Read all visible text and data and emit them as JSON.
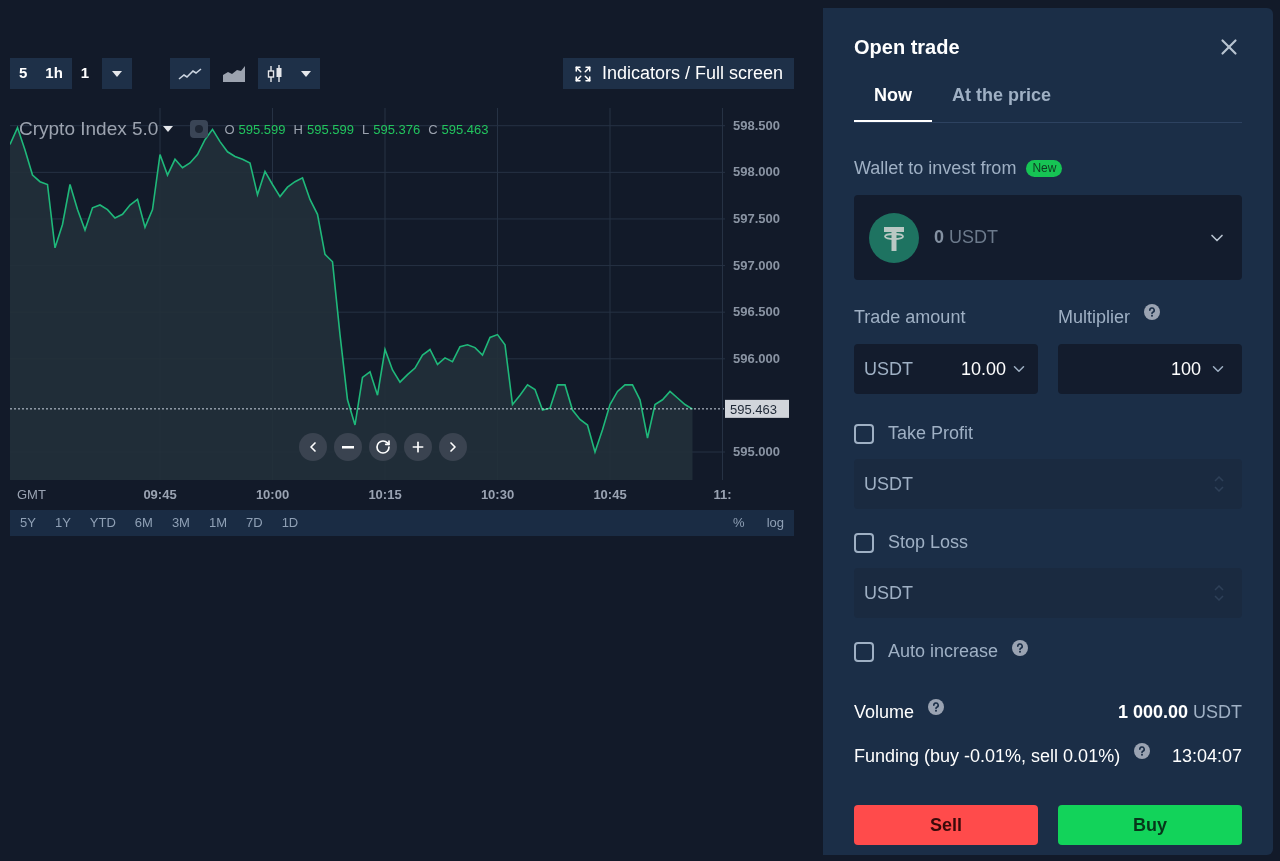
{
  "toolbar": {
    "intervals": [
      {
        "label": "5",
        "selected": false
      },
      {
        "label": "1h",
        "selected": false
      },
      {
        "label": "1",
        "selected": true
      }
    ],
    "chart_types": [
      {
        "kind": "line",
        "selected": false
      },
      {
        "kind": "area",
        "selected": true
      },
      {
        "kind": "candles",
        "selected": false
      }
    ],
    "indicators_button": "Indicators / Full screen"
  },
  "chart": {
    "ohlc": [
      {
        "label": "O",
        "value": "595.599"
      },
      {
        "label": "H",
        "value": "595.599"
      },
      {
        "label": "L",
        "value": "595.376"
      },
      {
        "label": "C",
        "value": "595.463"
      }
    ],
    "time_zone": "GMT",
    "cut_time_label": "11:",
    "chart_data": {
      "type": "area",
      "grid": true,
      "ylim": [
        594.7,
        598.69
      ],
      "ref_lines": [
        {
          "axis": "y",
          "value": 595.463,
          "label": "595.463"
        }
      ],
      "categories": [
        null,
        null,
        null,
        null,
        null,
        null,
        null,
        null,
        null,
        null,
        null,
        null,
        null,
        null,
        null,
        null,
        null,
        null,
        null,
        null,
        "09:45",
        null,
        null,
        null,
        null,
        null,
        null,
        null,
        null,
        null,
        null,
        null,
        null,
        null,
        null,
        "10:00",
        null,
        null,
        null,
        null,
        null,
        null,
        null,
        null,
        null,
        null,
        null,
        null,
        null,
        null,
        "10:15",
        null,
        null,
        null,
        null,
        null,
        null,
        null,
        null,
        null,
        null,
        null,
        null,
        null,
        null,
        "10:30",
        null,
        null,
        null,
        null,
        null,
        null,
        null,
        null,
        null,
        null,
        null,
        null,
        null,
        null,
        "10:45",
        null,
        null,
        null,
        null,
        null,
        null,
        null,
        null,
        null,
        null,
        null,
        null,
        null,
        null,
        null
      ],
      "yticks": [
        {
          "value": 595,
          "label": "595.000"
        },
        {
          "value": 596,
          "label": "596.000"
        },
        {
          "value": 596.5,
          "label": "596.500"
        },
        {
          "value": 597,
          "label": "597.000"
        },
        {
          "value": 597.5,
          "label": "597.500"
        },
        {
          "value": 598,
          "label": "598.000"
        },
        {
          "value": 598.5,
          "label": "598.500"
        }
      ],
      "series": [
        {
          "name": "Crypto Index 5.0",
          "color": "#1fb87a",
          "values": [
            598.3,
            598.48,
            598.24,
            597.97,
            597.9,
            597.87,
            597.19,
            597.44,
            597.87,
            597.6,
            597.38,
            597.62,
            597.65,
            597.6,
            597.51,
            597.55,
            597.65,
            597.71,
            597.41,
            597.6,
            598.19,
            597.97,
            598.14,
            598.05,
            598.1,
            598.19,
            598.35,
            598.46,
            598.33,
            598.22,
            598.17,
            598.14,
            598.1,
            597.76,
            598.01,
            597.87,
            597.74,
            597.84,
            597.9,
            597.94,
            597.71,
            597.55,
            597.12,
            597.04,
            596.26,
            595.56,
            595.29,
            595.8,
            595.86,
            595.61,
            596.1,
            595.88,
            595.75,
            595.83,
            595.9,
            596.04,
            596.1,
            595.94,
            596.01,
            595.97,
            596.13,
            596.15,
            596.12,
            596.04,
            596.23,
            596.26,
            596.15,
            595.51,
            595.61,
            595.72,
            595.67,
            595.45,
            595.47,
            595.72,
            595.72,
            595.45,
            595.35,
            595.29,
            595.0,
            595.24,
            595.51,
            595.65,
            595.72,
            595.72,
            595.56,
            595.15,
            595.51,
            595.56,
            595.65,
            595.58,
            595.51,
            595.46,
            null,
            null,
            null,
            null
          ]
        }
      ]
    }
  },
  "ranges": [
    "5Y",
    "1Y",
    "YTD",
    "6M",
    "3M",
    "1M",
    "7D",
    "1D"
  ],
  "scale_options": [
    "%",
    "log"
  ],
  "trade_panel": {
    "title": "Open trade",
    "tabs": [
      {
        "label": "Now",
        "selected": true
      },
      {
        "label": "At the price",
        "selected": false
      }
    ],
    "wallet": {
      "label": "Wallet to invest from",
      "badge": "New",
      "amount": "0",
      "currency": "USDT"
    },
    "trade_amount": {
      "label": "Trade amount",
      "currency": "USDT",
      "value": "10.00"
    },
    "multiplier": {
      "label": "Multiplier",
      "value": "100"
    },
    "options": [
      {
        "kind": "limit",
        "label": "Take Profit",
        "checked": false,
        "placeholder": "USDT"
      },
      {
        "kind": "limit",
        "label": "Stop Loss",
        "checked": false,
        "placeholder": "USDT"
      },
      {
        "kind": "toggle",
        "label": "Auto increase",
        "checked": false
      }
    ],
    "volume": {
      "label": "Volume",
      "amount": "1 000.00",
      "currency": "USDT"
    },
    "funding": {
      "label": "Funding (buy -0.01%, sell 0.01%)",
      "time": "13:04:07"
    },
    "buttons": [
      {
        "kind": "sell",
        "label": "Sell"
      },
      {
        "kind": "buy",
        "label": "Buy"
      }
    ]
  }
}
